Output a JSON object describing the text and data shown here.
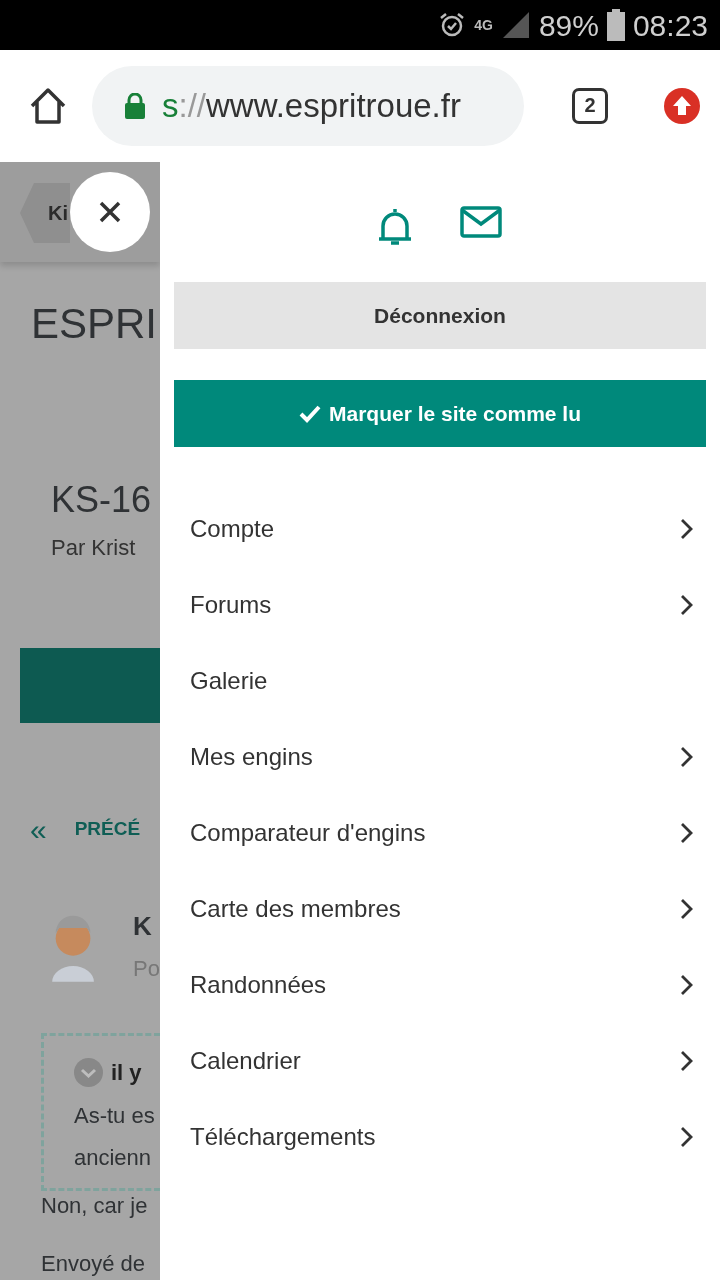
{
  "status_bar": {
    "network": "4G",
    "battery": "89%",
    "time": "08:23"
  },
  "browser": {
    "url_scheme": "s",
    "url_separator": "://",
    "url_host": "www.espritroue.fr",
    "tab_count": "2"
  },
  "page": {
    "breadcrumb": "Ki",
    "title": "ESPRI",
    "thread_title": "KS-16",
    "thread_author": "Par Krist",
    "pager_arrow": "«",
    "pager_prev": "PRÉCÉ",
    "post_author": "K",
    "post_meta": "Po",
    "quote_title": "il y",
    "quote_lines": [
      "As-tu es",
      "ancienn"
    ],
    "reply_lines": [
      "Non, car je"
    ],
    "signature": "Envoyé de"
  },
  "drawer": {
    "logout": "Déconnexion",
    "mark_read": "Marquer le site comme lu",
    "menu": [
      {
        "label": "Compte",
        "has_submenu": true
      },
      {
        "label": "Forums",
        "has_submenu": true
      },
      {
        "label": "Galerie",
        "has_submenu": false
      },
      {
        "label": "Mes engins",
        "has_submenu": true
      },
      {
        "label": "Comparateur d'engins",
        "has_submenu": true
      },
      {
        "label": "Carte des membres",
        "has_submenu": true
      },
      {
        "label": "Randonnées",
        "has_submenu": true
      },
      {
        "label": "Calendrier",
        "has_submenu": true
      },
      {
        "label": "Téléchargements",
        "has_submenu": true
      }
    ]
  }
}
